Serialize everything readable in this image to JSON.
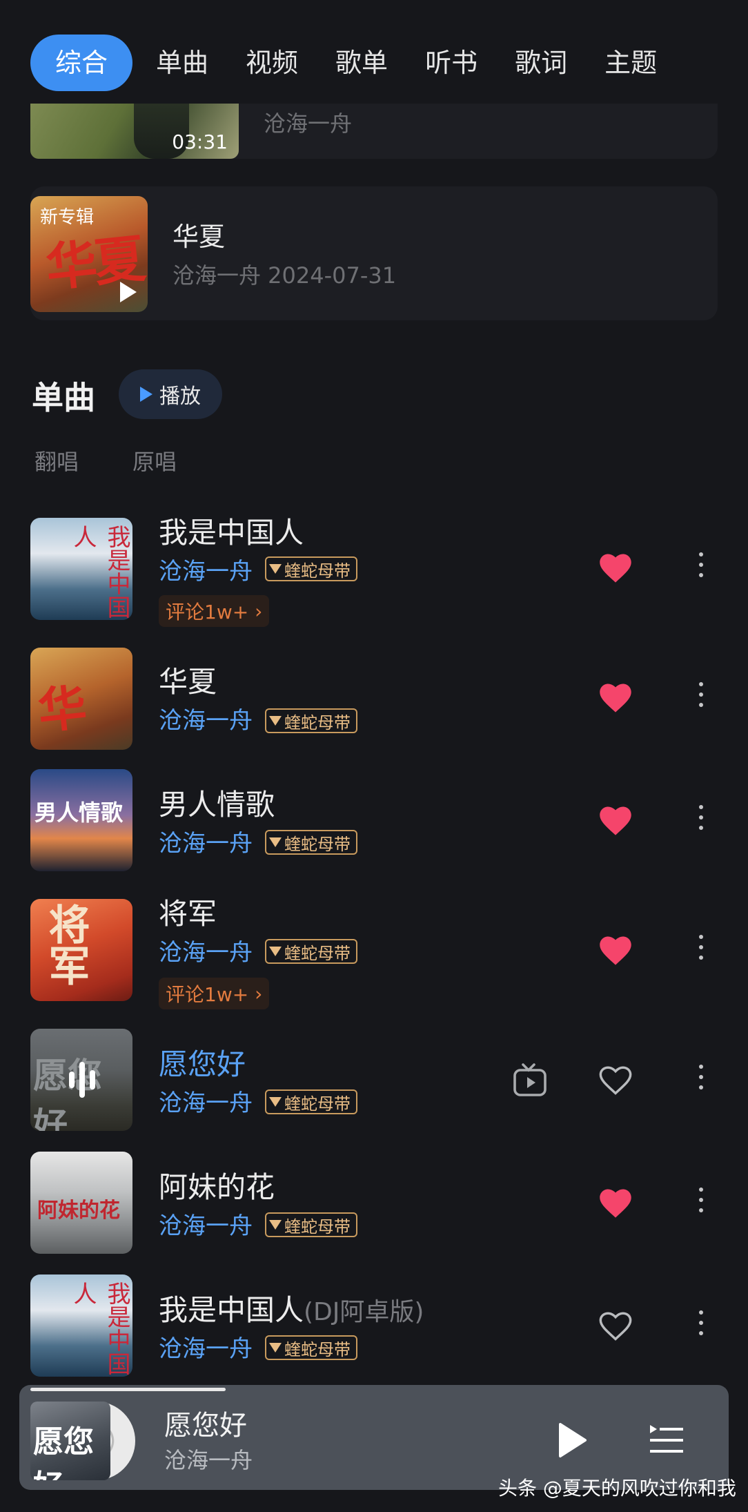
{
  "tabs": [
    "综合",
    "单曲",
    "视频",
    "歌单",
    "听书",
    "歌词",
    "主题"
  ],
  "video": {
    "duration": "03:31",
    "artist": "沧海一舟"
  },
  "album": {
    "badge": "新专辑",
    "cover_text": "华夏",
    "title": "华夏",
    "meta": "沧海一舟 2024-07-31"
  },
  "section": {
    "title": "单曲",
    "play_label": "播放",
    "filters": [
      "翻唱",
      "原唱"
    ]
  },
  "tag_label": "蝰蛇母带",
  "songs": [
    {
      "title": "我是中国人",
      "artist": "沧海一舟",
      "comment": "评论1w+",
      "liked": true
    },
    {
      "title": "华夏",
      "artist": "沧海一舟",
      "liked": true
    },
    {
      "title": "男人情歌",
      "artist": "沧海一舟",
      "liked": true
    },
    {
      "title": "将军",
      "artist": "沧海一舟",
      "comment": "评论1w+",
      "liked": true
    },
    {
      "title": "愿您好",
      "artist": "沧海一舟",
      "liked": false,
      "playing": true
    },
    {
      "title": "阿妹的花",
      "artist": "沧海一舟",
      "liked": true
    },
    {
      "title": "我是中国人",
      "title_suffix": "(DJ阿卓版)",
      "artist": "沧海一舟",
      "liked": false
    }
  ],
  "player": {
    "title": "愿您好",
    "artist": "沧海一舟",
    "cover_text": "愿您好",
    "progress": 0.28
  },
  "watermark": "头条 @夏天的风吹过你和我",
  "colors": {
    "accent": "#3d8ff2",
    "artist": "#5aa2f5",
    "heart": "#f5456b",
    "tag": "#e9bd85"
  }
}
